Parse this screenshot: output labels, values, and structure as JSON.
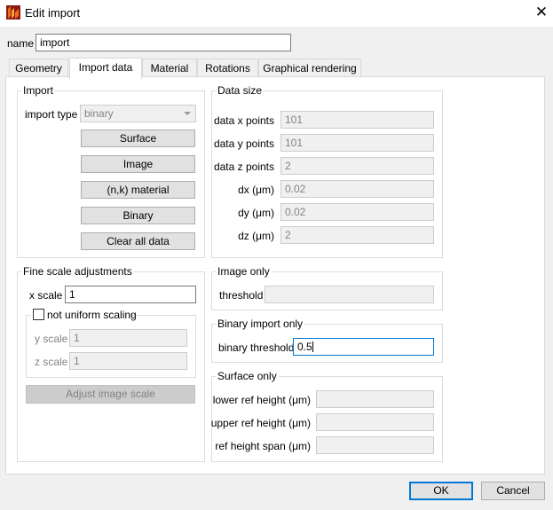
{
  "window": {
    "title": "Edit import",
    "close_glyph": "✕",
    "app_icon": "lumerical-app-icon"
  },
  "name_field": {
    "label": "name",
    "value": "import"
  },
  "tabs": [
    {
      "label": "Geometry",
      "active": false
    },
    {
      "label": "Import data",
      "active": true
    },
    {
      "label": "Material",
      "active": false
    },
    {
      "label": "Rotations",
      "active": false
    },
    {
      "label": "Graphical rendering",
      "active": false
    }
  ],
  "import_group": {
    "title": "Import",
    "import_type_label": "import type",
    "import_type_value": "binary",
    "buttons": {
      "surface": "Surface",
      "image": "Image",
      "nk_material": "(n,k) material",
      "binary": "Binary",
      "clear": "Clear all data"
    }
  },
  "data_size": {
    "title": "Data size",
    "rows": [
      {
        "label": "data x points",
        "value": "101"
      },
      {
        "label": "data y points",
        "value": "101"
      },
      {
        "label": "data z points",
        "value": "2"
      },
      {
        "label": "dx (μm)",
        "value": "0.02"
      },
      {
        "label": "dy (μm)",
        "value": "0.02"
      },
      {
        "label": "dz (μm)",
        "value": "2"
      }
    ]
  },
  "fine_scale": {
    "title": "Fine scale adjustments",
    "x_scale_label": "x scale",
    "x_scale_value": "1",
    "not_uniform_label": "not uniform scaling",
    "not_uniform_checked": false,
    "y_scale_label": "y scale",
    "y_scale_value": "1",
    "z_scale_label": "z scale",
    "z_scale_value": "1",
    "adjust_button": "Adjust image scale"
  },
  "image_only": {
    "title": "Image only",
    "threshold_label": "threshold",
    "threshold_value": ""
  },
  "binary_only": {
    "title": "Binary import only",
    "threshold_label": "binary threshold",
    "threshold_value": "0.5"
  },
  "surface_only": {
    "title": "Surface only",
    "rows": [
      {
        "label": "lower ref height (μm)",
        "value": ""
      },
      {
        "label": "upper ref height (μm)",
        "value": ""
      },
      {
        "label": "ref height span (μm)",
        "value": ""
      }
    ]
  },
  "footer": {
    "ok": "OK",
    "cancel": "Cancel"
  },
  "colors": {
    "accent": "#0078d7",
    "icon_orange": "#f26b1d",
    "icon_dark": "#8b1a10"
  }
}
